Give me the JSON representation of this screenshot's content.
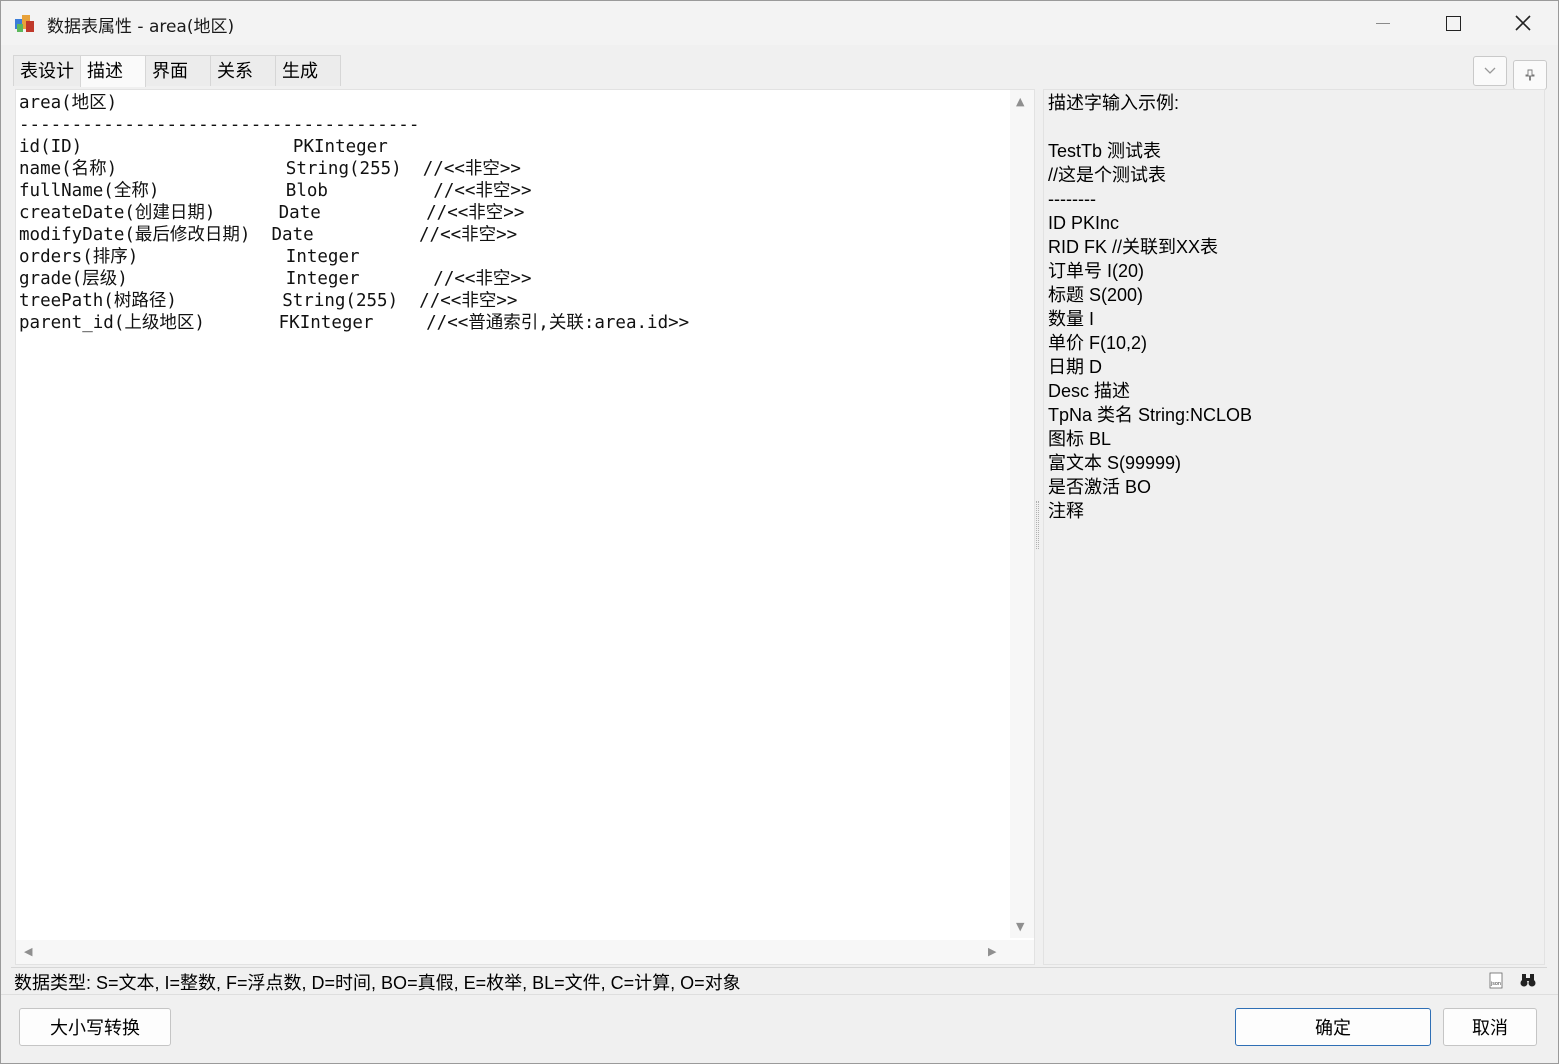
{
  "window": {
    "title": "数据表属性 - area(地区)"
  },
  "tabs": [
    {
      "label": "表设计",
      "active": false
    },
    {
      "label": "描述",
      "active": true
    },
    {
      "label": "界面",
      "active": false
    },
    {
      "label": "关系",
      "active": false
    },
    {
      "label": "生成",
      "active": false
    }
  ],
  "editor": {
    "lines": [
      "area(地区)",
      "--------------------------------------",
      "id(ID)                    PKInteger",
      "name(名称)                String(255)  //<<非空>>",
      "fullName(全称)            Blob          //<<非空>>",
      "createDate(创建日期)      Date          //<<非空>>",
      "modifyDate(最后修改日期)  Date          //<<非空>>",
      "orders(排序)              Integer",
      "grade(层级)               Integer       //<<非空>>",
      "treePath(树路径)          String(255)  //<<非空>>",
      "parent_id(上级地区)       FKInteger     //<<普通索引,关联:area.id>>"
    ]
  },
  "hint": {
    "lines": [
      "描述字输入示例:",
      "",
      "TestTb 测试表",
      "//这是个测试表",
      "--------",
      "ID PKInc",
      "RID FK //关联到XX表",
      "订单号 I(20)",
      "标题 S(200)",
      "数量 I",
      "单价 F(10,2)",
      "日期 D",
      "Desc 描述",
      "TpNa 类名 String:NCLOB",
      "图标 BL",
      "富文本 S(99999)",
      "是否激活 BO",
      "注释"
    ]
  },
  "status": {
    "text": "数据类型: S=文本, I=整数, F=浮点数, D=时间, BO=真假, E=枚举, BL=文件, C=计算, O=对象",
    "json_icon_label": "json"
  },
  "buttons": {
    "case_convert": "大小写转换",
    "ok": "确定",
    "cancel": "取消"
  },
  "colors": {
    "accent": "#2f6fb5",
    "window_bg": "#f0f0f0",
    "editor_bg": "#ffffff"
  }
}
